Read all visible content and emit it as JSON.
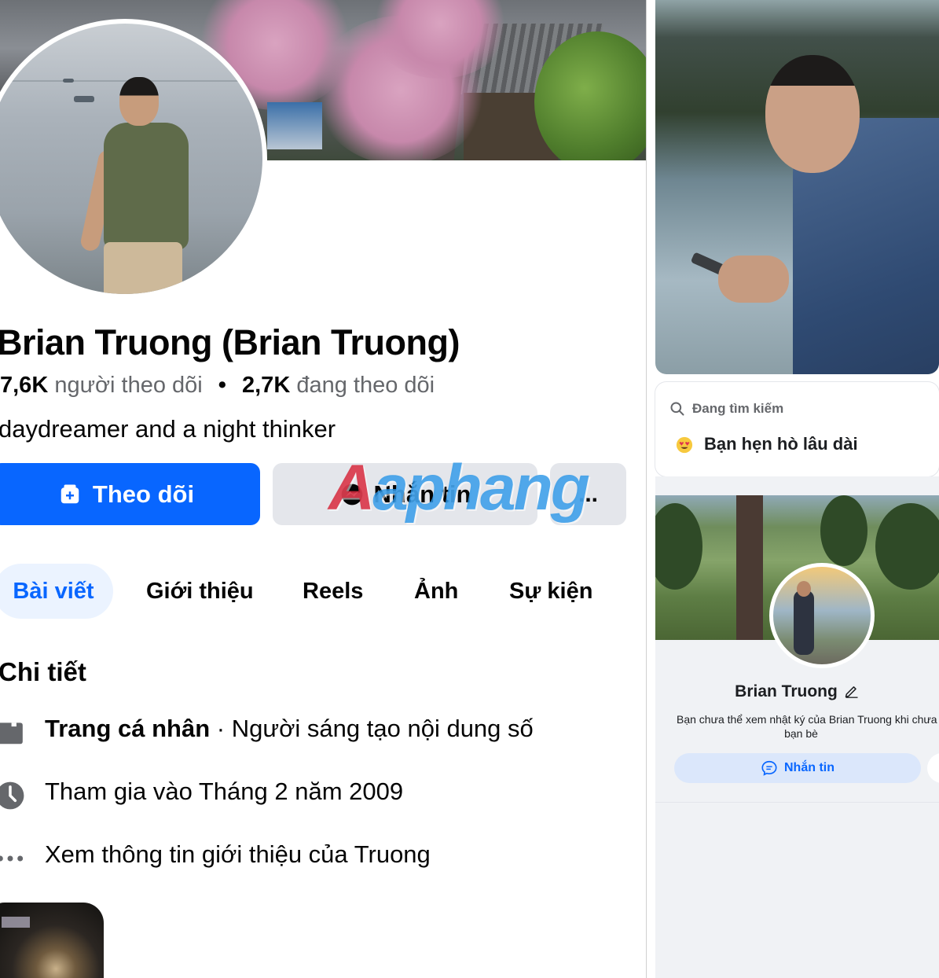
{
  "profile": {
    "name": "Brian Truong (Brian Truong)",
    "followers_count": "7,6K",
    "followers_label": "người theo dõi",
    "following_count": "2,7K",
    "following_label": "đang theo dõi",
    "bio": "daydreamer and a night thinker"
  },
  "actions": {
    "follow_label": "Theo dõi",
    "message_label": "Nhắn tin",
    "more_label": "..."
  },
  "watermark": {
    "text": "aphang"
  },
  "tabs": [
    {
      "label": "Bài viết",
      "active": true
    },
    {
      "label": "Giới thiệu",
      "active": false
    },
    {
      "label": "Reels",
      "active": false
    },
    {
      "label": "Ảnh",
      "active": false
    },
    {
      "label": "Sự kiện",
      "active": false
    }
  ],
  "details": {
    "title": "Chi tiết",
    "page_type_bold": "Trang cá nhân",
    "page_type_rest": " · Người sáng tạo nội dung số",
    "joined": "Tham gia vào Tháng 2 năm 2009",
    "see_more": "Xem thông tin giới thiệu của Truong"
  },
  "dating": {
    "looking_label": "Đang tìm kiếm",
    "looking_value": "Bạn hẹn hò lâu dài"
  },
  "mini_profile": {
    "name": "Brian Truong",
    "note_line1": "Bạn chưa thể xem nhật ký của Brian Truong khi chưa là",
    "note_line2": "bạn bè",
    "message_label": "Nhắn tin"
  },
  "colors": {
    "accent": "#0866ff",
    "button_gray": "#e4e6eb",
    "tab_active_bg": "#ebf3ff",
    "secondary_text": "#65676b",
    "page_bg": "#f0f2f5"
  },
  "icons": {
    "follow": "user-add-icon",
    "message": "messenger-icon",
    "page_type": "flag-icon",
    "joined": "clock-icon",
    "see_more": "more-horizontal-icon",
    "search": "search-icon",
    "emoji": "heart-eyes-emoji-icon",
    "edit": "pencil-edit-icon",
    "chat": "chat-bubble-icon"
  }
}
